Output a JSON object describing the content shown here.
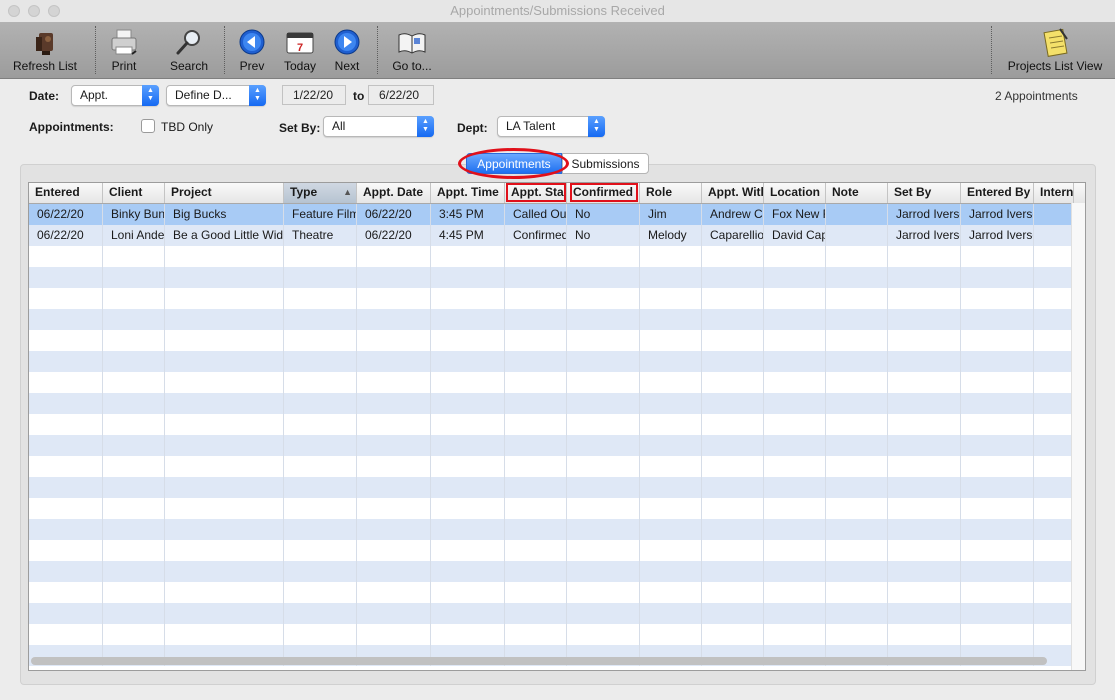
{
  "window": {
    "title": "Appointments/Submissions Received"
  },
  "toolbar": {
    "refresh": "Refresh List",
    "print": "Print",
    "search": "Search",
    "prev": "Prev",
    "today": "Today",
    "next": "Next",
    "goto": "Go to...",
    "projects_view": "Projects List View",
    "calendar_day": "7"
  },
  "filters": {
    "date_label": "Date:",
    "date_type": "Appt.",
    "date_range": "Define D...",
    "from": "1/22/20",
    "to_label": "to",
    "to": "6/22/20",
    "count": "2 Appointments",
    "appointments_label": "Appointments:",
    "tbd_label": "TBD Only",
    "setby_label": "Set By:",
    "setby_value": "All",
    "dept_label": "Dept:",
    "dept_value": "LA Talent"
  },
  "tabs": {
    "appointments": "Appointments",
    "submissions": "Submissions"
  },
  "table": {
    "columns": [
      "Entered",
      "Client",
      "Project",
      "Type",
      "Appt. Date",
      "Appt. Time",
      "Appt. Sta",
      "Confirmed",
      "Role",
      "Appt. Witl",
      "Location",
      "Note",
      "Set By",
      "Entered By",
      "Internal"
    ],
    "sort_indicator": "▲",
    "rows": [
      [
        "06/22/20",
        "Binky Bun",
        "Big Bucks",
        "Feature Film",
        "06/22/20",
        "3:45 PM",
        "Called Out",
        "No",
        "Jim",
        "Andrew Ca",
        "Fox New R",
        "",
        "Jarrod Iverso",
        "Jarrod Iverso",
        ""
      ],
      [
        "06/22/20",
        "Loni Ande",
        "Be a Good Little Wido",
        "Theatre",
        "06/22/20",
        "4:45 PM",
        "Confirmed",
        "No",
        "Melody",
        "Caparellio",
        "David Cap",
        "",
        "Jarrod Iverso",
        "Jarrod Iverso",
        ""
      ]
    ]
  },
  "colors": {
    "accent": "#2a76ee",
    "highlight": "#e0101a",
    "selected_row": "#a8cbf5",
    "stripe": "#dfe8f6"
  }
}
